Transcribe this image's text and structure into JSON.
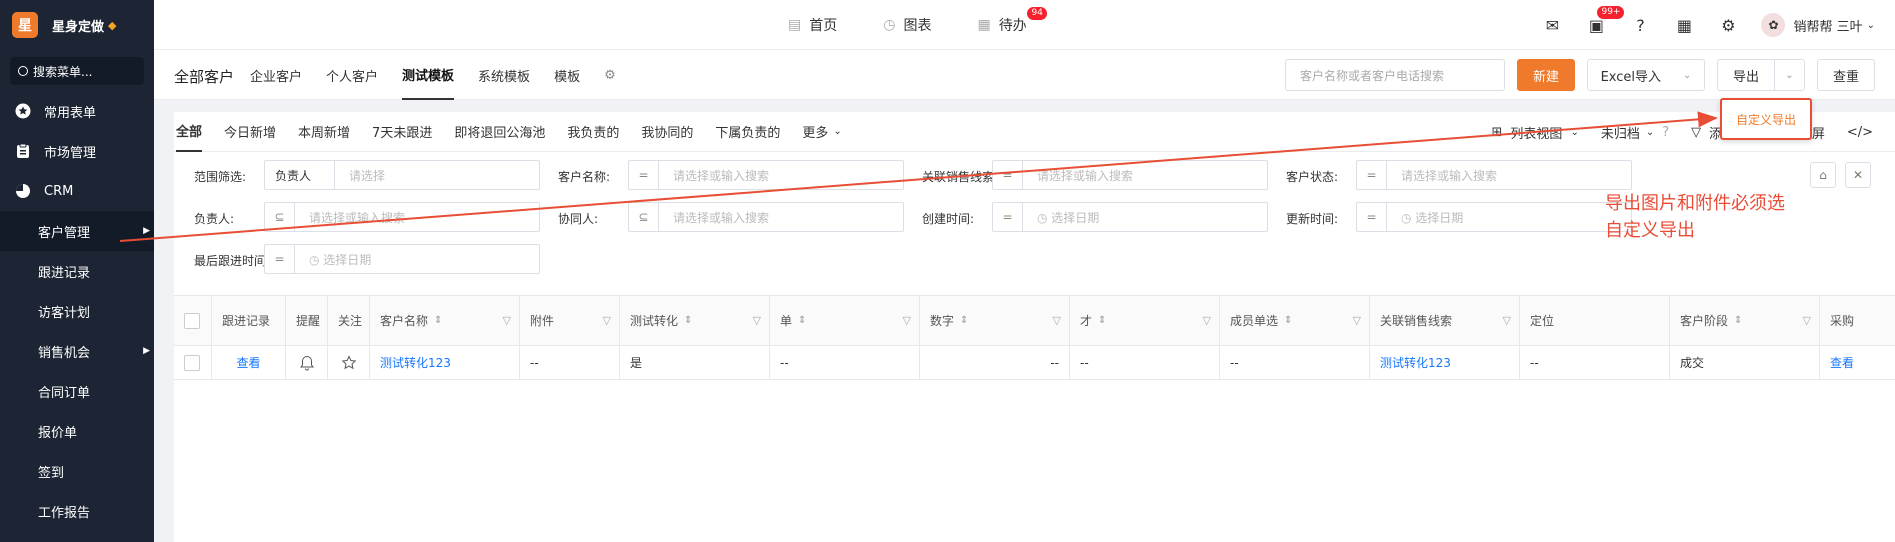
{
  "app": {
    "logo_char": "星",
    "name": "星身定做",
    "brand_color": "#f07a2b"
  },
  "sidebar": {
    "search": "搜索菜单...",
    "items": [
      {
        "label": "常用表单",
        "icon": "star-icon"
      },
      {
        "label": "市场管理",
        "icon": "clipboard-icon"
      },
      {
        "label": "CRM",
        "icon": "pie-icon"
      },
      {
        "label": "客户管理"
      },
      {
        "label": "跟进记录"
      },
      {
        "label": "访客计划"
      },
      {
        "label": "销售机会"
      },
      {
        "label": "合同订单"
      },
      {
        "label": "报价单"
      },
      {
        "label": "签到"
      },
      {
        "label": "工作报告"
      }
    ]
  },
  "topnav": {
    "home": "首页",
    "charts": "图表",
    "todo": "待办",
    "todo_badge": "94",
    "msg_badge": "99+"
  },
  "user": {
    "name": "销帮帮 三叶"
  },
  "header": {
    "title": "全部客户",
    "tabs": [
      "企业客户",
      "个人客户",
      "测试模板",
      "系统模板",
      "模板"
    ],
    "search_placeholder": "客户名称或者客户电话搜索",
    "new": "新建",
    "excel": "Excel导入",
    "export": "导出",
    "reset": "查重"
  },
  "filter_tabs": [
    "全部",
    "今日新增",
    "本周新增",
    "7天未跟进",
    "即将退回公海池",
    "我负责的",
    "我协同的",
    "下属负责的",
    "更多"
  ],
  "filter_right": {
    "view": "列表视图",
    "archive": "未归档",
    "add_filter": "添加筛选",
    "fullscreen": "全屏"
  },
  "filters": {
    "scope_label": "范围筛选:",
    "scope_value": "负责人",
    "scope_ph": "请选择",
    "cust_name": "客户名称:",
    "cust_name_ph": "请选择或输入搜索",
    "clue": "关联销售线索:",
    "clue_ph": "请选择或输入搜索",
    "status": "客户状态:",
    "status_ph": "请选择或输入搜索",
    "owner": "负责人:",
    "owner_ph": "请选择或输入搜索",
    "coop": "协同人:",
    "coop_ph": "请选择或输入搜索",
    "created": "创建时间:",
    "created_ph": "选择日期",
    "updated": "更新时间:",
    "updated_ph": "选择日期",
    "last_follow": "最后跟进时间:",
    "last_follow_ph": "选择日期"
  },
  "table": {
    "columns": [
      "跟进记录",
      "提醒",
      "关注",
      "客户名称",
      "附件",
      "测试转化",
      "单",
      "数字",
      "才",
      "成员单选",
      "关联销售线索",
      "定位",
      "客户阶段",
      "采购"
    ],
    "row": {
      "view": "查看",
      "name": "测试转化123",
      "attach": "--",
      "conv": "是",
      "dan": "--",
      "num": "--",
      "cai": "--",
      "member": "--",
      "clue": "测试转化123",
      "loc": "--",
      "stage": "成交",
      "more": "查看"
    }
  },
  "popover": {
    "label": "自定义导出"
  },
  "annotation": {
    "line1": "导出图片和附件必须选",
    "line2": "自定义导出",
    "color": "#e84d36"
  }
}
